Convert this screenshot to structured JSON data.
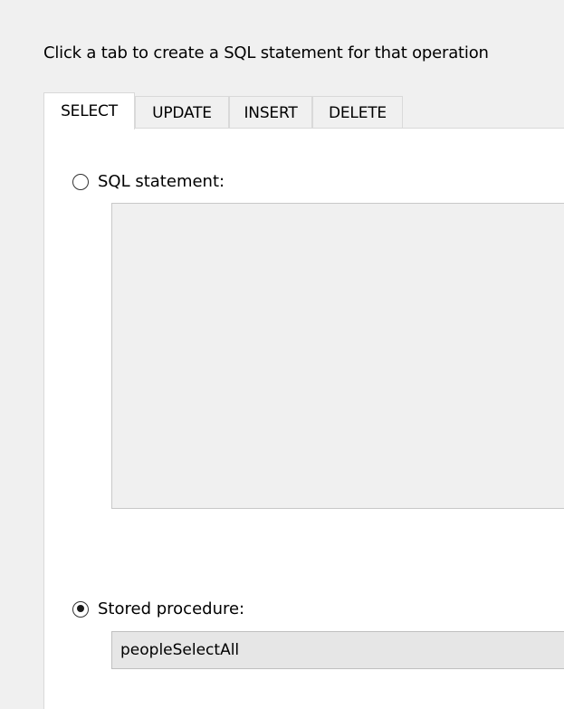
{
  "instruction": "Click a tab to create a SQL statement for that operation",
  "tabs": [
    {
      "label": "SELECT",
      "active": true
    },
    {
      "label": "UPDATE",
      "active": false
    },
    {
      "label": "INSERT",
      "active": false
    },
    {
      "label": "DELETE",
      "active": false
    }
  ],
  "select_panel": {
    "sql_statement": {
      "label": "SQL statement:",
      "selected": false,
      "text": ""
    },
    "stored_procedure": {
      "label": "Stored procedure:",
      "selected": true,
      "value": "peopleSelectAll"
    }
  }
}
